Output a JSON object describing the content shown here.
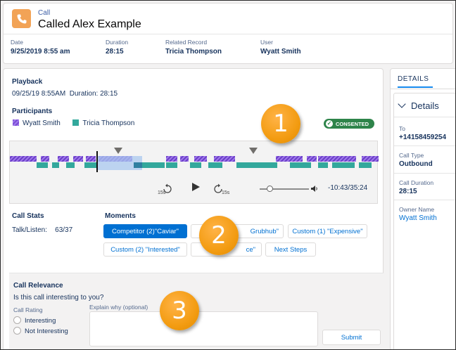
{
  "header": {
    "object_label": "Call",
    "title": "Called Alex Example",
    "icon": "phone-icon",
    "fields": [
      {
        "label": "Date",
        "value": "9/25/2019 8:55 am"
      },
      {
        "label": "Duration",
        "value": "28:15"
      },
      {
        "label": "Related Record",
        "value": "Tricia Thompson"
      },
      {
        "label": "User",
        "value": "Wyatt Smith"
      }
    ]
  },
  "playback": {
    "title": "Playback",
    "datetime": "09/25/19 8:55AM",
    "duration_text": "Duration: 28:15",
    "participants_title": "Participants",
    "participants": [
      {
        "name": "Wyatt Smith",
        "color": "#7b4bd6"
      },
      {
        "name": "Tricia Thompson",
        "color": "#33a89c"
      }
    ],
    "consent_badge": "CONSENTED",
    "rewind_label": "15s",
    "forward_label": "15s",
    "volume_level": 0.2,
    "time": "-10:43/35:24"
  },
  "call_stats": {
    "title": "Call Stats",
    "talk_listen_label": "Talk/Listen:",
    "talk_listen_value": "63/37"
  },
  "moments": {
    "title": "Moments",
    "buttons": [
      {
        "label": "Competitor (2)\"Caviar\"",
        "selected": true
      },
      {
        "label": "Grubhub\"",
        "selected": false
      },
      {
        "label": "Custom (1) \"Expensive\"",
        "selected": false
      },
      {
        "label": "Custom (2)  \"Interested\"",
        "selected": false
      },
      {
        "label": "ce\"",
        "selected": false
      },
      {
        "label": "Next Steps",
        "selected": false
      }
    ]
  },
  "relevance": {
    "title": "Call Relevance",
    "question": "Is this call interesting to you?",
    "rating_label": "Call Rating",
    "options": [
      "Interesting",
      "Not Interesting"
    ],
    "explain_label": "Explain why (optional)",
    "submit_label": "Submit"
  },
  "callouts": [
    "1",
    "2",
    "3"
  ],
  "details": {
    "tab": "DETAILS",
    "section": "Details",
    "fields": [
      {
        "label": "To",
        "value": "+14158459254"
      },
      {
        "label": "Call Type",
        "value": "Outbound"
      },
      {
        "label": "Call Duration",
        "value": "28:15"
      },
      {
        "label": "Owner Name",
        "value": "Wyatt Smith"
      }
    ]
  },
  "colors": {
    "accent": "#0070d2",
    "speaker_a": "#7b4bd6",
    "speaker_b": "#33a89c",
    "consent": "#2e844a",
    "callout": "#f39c12"
  }
}
